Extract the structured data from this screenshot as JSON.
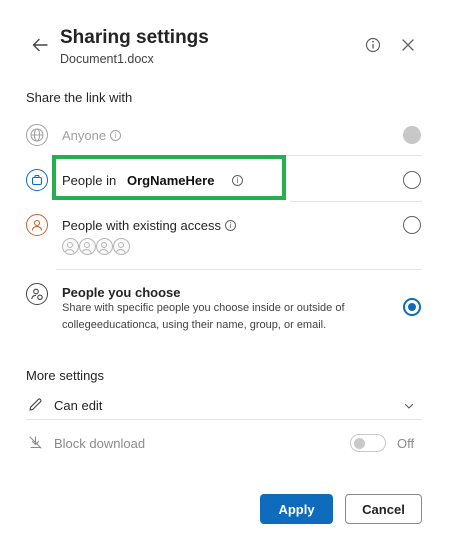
{
  "header": {
    "title": "Sharing settings",
    "subtitle": "Document1.docx"
  },
  "share_section": {
    "label": "Share the link with",
    "options": [
      {
        "label": "Anyone",
        "state": "disabled"
      },
      {
        "label": "People in",
        "org_name": "OrgNameHere",
        "state": "unselected"
      },
      {
        "label": "People with existing access",
        "state": "unselected"
      },
      {
        "label": "People you choose",
        "description": "Share with specific people you choose inside or outside of collegeeducationca, using their name, group, or email.",
        "state": "selected"
      }
    ]
  },
  "more_settings": {
    "label": "More settings",
    "permission": "Can edit",
    "block_download_label": "Block download",
    "block_download_state": "Off"
  },
  "buttons": {
    "apply": "Apply",
    "cancel": "Cancel"
  },
  "colors": {
    "accent": "#0f6cbd",
    "highlight_box": "#22b14c"
  }
}
